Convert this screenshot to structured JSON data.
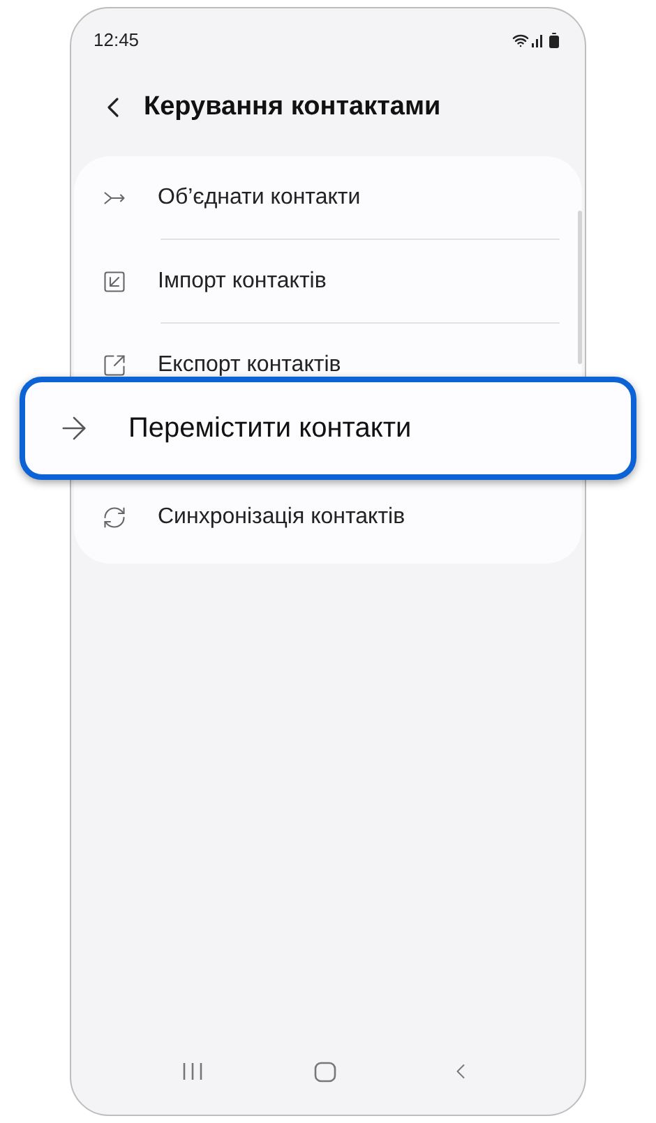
{
  "status_bar": {
    "time": "12:45"
  },
  "header": {
    "title": "Керування контактами"
  },
  "menu": [
    {
      "label": "Об’єднати контакти",
      "highlighted": false
    },
    {
      "label": "Імпорт контактів",
      "highlighted": false
    },
    {
      "label": "Експорт контактів",
      "highlighted": false
    },
    {
      "label": "Перемістити контакти",
      "highlighted": true
    },
    {
      "label": "Синхронізація контактів",
      "highlighted": false
    }
  ]
}
